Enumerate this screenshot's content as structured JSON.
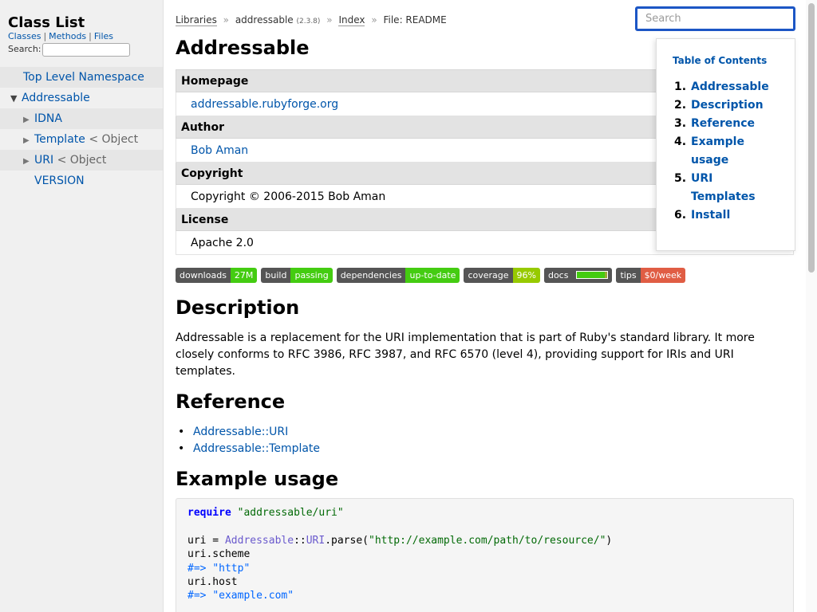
{
  "sidebar": {
    "title": "Class List",
    "links": {
      "classes": "Classes",
      "methods": "Methods",
      "files": "Files",
      "separator": "|"
    },
    "search_label": "Search:",
    "items": [
      {
        "label": "Top Level Namespace",
        "suffix": ""
      },
      {
        "label": "Addressable",
        "suffix": ""
      },
      {
        "label": "IDNA",
        "suffix": ""
      },
      {
        "label": "Template",
        "suffix": "< Object"
      },
      {
        "label": "URI",
        "suffix": "< Object"
      },
      {
        "label": "VERSION",
        "suffix": ""
      }
    ]
  },
  "breadcrumb": {
    "libraries": "Libraries",
    "library": "addressable",
    "version": "(2.3.8)",
    "index": "Index",
    "file": "File: README",
    "separator": "»"
  },
  "search": {
    "placeholder": "Search"
  },
  "page_title": "Addressable",
  "meta": {
    "homepage_label": "Homepage",
    "homepage_value": "addressable.rubyforge.org",
    "author_label": "Author",
    "author_value": "Bob Aman",
    "copyright_label": "Copyright",
    "copyright_value": "Copyright © 2006-2015 Bob Aman",
    "license_label": "License",
    "license_value": "Apache 2.0"
  },
  "badges": [
    {
      "label": "downloads",
      "value": "27M",
      "color": "#4c1"
    },
    {
      "label": "build",
      "value": "passing",
      "color": "#4c1"
    },
    {
      "label": "dependencies",
      "value": "up-to-date",
      "color": "#4c1"
    },
    {
      "label": "coverage",
      "value": "96%",
      "color": "#97ca00"
    },
    {
      "label": "docs",
      "value": "",
      "color": "#4c1"
    },
    {
      "label": "tips",
      "value": "$0/week",
      "color": "#e05d44"
    }
  ],
  "description": {
    "heading": "Description",
    "text": "Addressable is a replacement for the URI implementation that is part of Ruby's standard library. It more closely conforms to RFC 3986, RFC 3987, and RFC 6570 (level 4), providing support for IRIs and URI templates."
  },
  "reference": {
    "heading": "Reference",
    "items": [
      "Addressable::URI",
      "Addressable::Template"
    ]
  },
  "example": {
    "heading": "Example usage",
    "code": {
      "kw_require": "require",
      "str_lib": "\"addressable/uri\"",
      "uri_assign": "uri = ",
      "const_addressable": "Addressable",
      "sep": "::",
      "const_uri": "URI",
      "parse_open": ".parse(",
      "str_url": "\"http://example.com/path/to/resource/\"",
      "paren_close": ")",
      "line_scheme": "uri.scheme",
      "cmt_arrow": "#=>",
      "str_http": "\"http\"",
      "line_host": "uri.host",
      "str_host": "\"example.com\""
    }
  },
  "toc": {
    "title": "Table of Contents",
    "items": [
      {
        "num": "1.",
        "label": "Addressable"
      },
      {
        "num": "2.",
        "label": "Description"
      },
      {
        "num": "3.",
        "label": "Reference"
      },
      {
        "num": "4.",
        "label": "Example usage"
      },
      {
        "num": "5.",
        "label": "URI Templates"
      },
      {
        "num": "6.",
        "label": "Install"
      }
    ]
  }
}
